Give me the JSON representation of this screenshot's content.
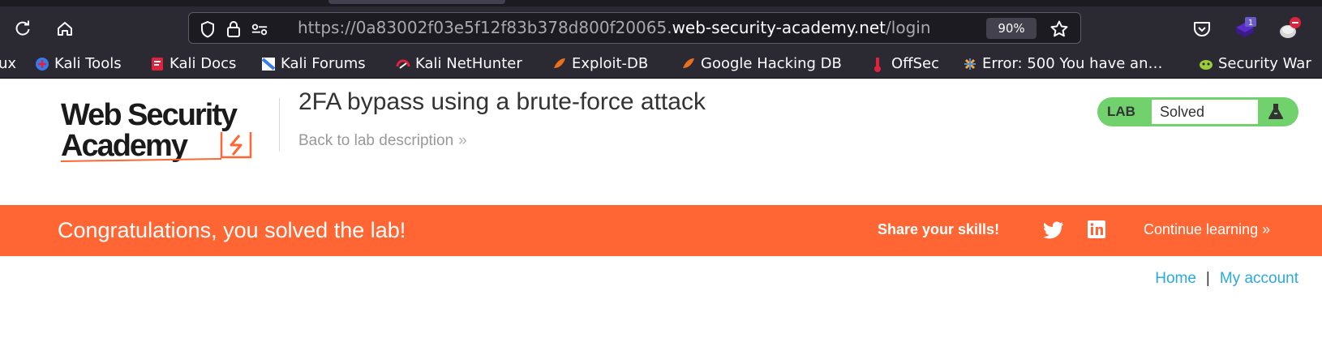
{
  "browser": {
    "url": {
      "scheme": "https://",
      "subdomain": "0a83002f03e5f12f83b378d800f20065.",
      "domain": "web-security-academy.net",
      "path": "/login"
    },
    "zoom": "90%",
    "extension_badge": "1",
    "bookmarks": [
      {
        "label": "ux",
        "icon": "kali-icon"
      },
      {
        "label": "Kali Tools",
        "icon": "kali-tools-icon"
      },
      {
        "label": "Kali Docs",
        "icon": "kali-docs-icon"
      },
      {
        "label": "Kali Forums",
        "icon": "kali-forums-icon"
      },
      {
        "label": "Kali NetHunter",
        "icon": "nethunter-icon"
      },
      {
        "label": "Exploit-DB",
        "icon": "exploit-db-icon"
      },
      {
        "label": "Google Hacking DB",
        "icon": "ghdb-icon"
      },
      {
        "label": "OffSec",
        "icon": "offsec-icon"
      },
      {
        "label": "Error: 500 You have an…",
        "icon": "joomla-icon"
      },
      {
        "label": "Security War",
        "icon": "security-war-icon"
      }
    ]
  },
  "page": {
    "logo_line1": "Web Security",
    "logo_line2": "Academy",
    "lab_title": "2FA bypass using a brute-force attack",
    "back_link": "Back to lab description",
    "back_chevron": "»",
    "lab_label": "LAB",
    "lab_status": "Solved",
    "banner": {
      "message": "Congratulations, you solved the lab!",
      "share": "Share your skills!",
      "continue": "Continue learning »"
    },
    "nav": {
      "home": "Home",
      "separator": "|",
      "account": "My account"
    }
  },
  "colors": {
    "banner": "#ff6633",
    "lab_badge": "#70d16d",
    "link": "#29a9e1",
    "chrome": "#2b2a33"
  }
}
